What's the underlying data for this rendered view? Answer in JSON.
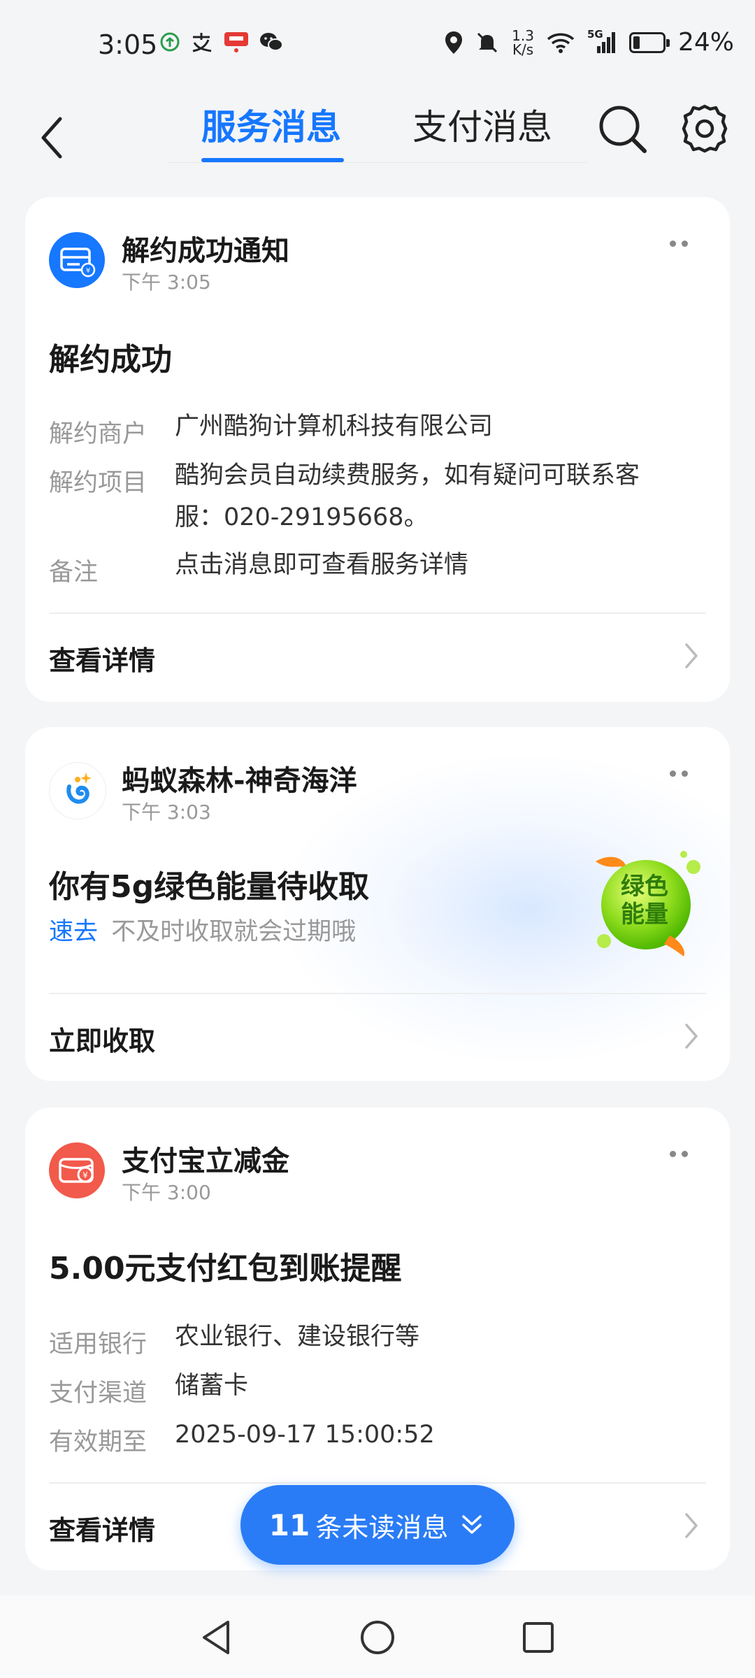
{
  "status_bar": {
    "time": "3:05",
    "speed_value": "1.3",
    "speed_unit": "K/s",
    "network": "5G",
    "battery": "24%",
    "left_icons": [
      "ant-forest-icon",
      "alipay-icon",
      "red-app-icon",
      "wechat-icon"
    ],
    "right_icons": [
      "location-icon",
      "mute-icon",
      "wifi-icon",
      "signal-icon",
      "battery-icon"
    ]
  },
  "header": {
    "tabs": [
      {
        "label": "服务消息",
        "active": true
      },
      {
        "label": "支付消息",
        "active": false
      }
    ],
    "accent_color": "#1677ff"
  },
  "cards": [
    {
      "title": "解约成功通知",
      "time": "下午 3:05",
      "heading": "解约成功",
      "rows": [
        {
          "label": "解约商户",
          "value": "广州酷狗计算机科技有限公司"
        },
        {
          "label": "解约项目",
          "value": "酷狗会员自动续费服务，如有疑问可联系客服：020-29195668。"
        },
        {
          "label": "备注",
          "value": "点击消息即可查看服务详情"
        }
      ],
      "action": "查看详情",
      "avatar_color": "#1677ff"
    },
    {
      "title": "蚂蚁森林-神奇海洋",
      "time": "下午 3:03",
      "heading": "你有5g绿色能量待收取",
      "link": "速去",
      "subtext": "不及时收取就会过期哦",
      "badge_line1": "绿色",
      "badge_line2": "能量",
      "action": "立即收取"
    },
    {
      "title": "支付宝立减金",
      "time": "下午 3:00",
      "heading": "5.00元支付红包到账提醒",
      "rows": [
        {
          "label": "适用银行",
          "value": "农业银行、建设银行等"
        },
        {
          "label": "支付渠道",
          "value": "储蓄卡"
        },
        {
          "label": "有效期至",
          "value": "2025-09-17 15:00:52"
        }
      ],
      "action": "查看详情",
      "avatar_color": "#f25a4b"
    }
  ],
  "unread": {
    "count": "11",
    "text": "条未读消息",
    "color": "#2a7cf6"
  }
}
